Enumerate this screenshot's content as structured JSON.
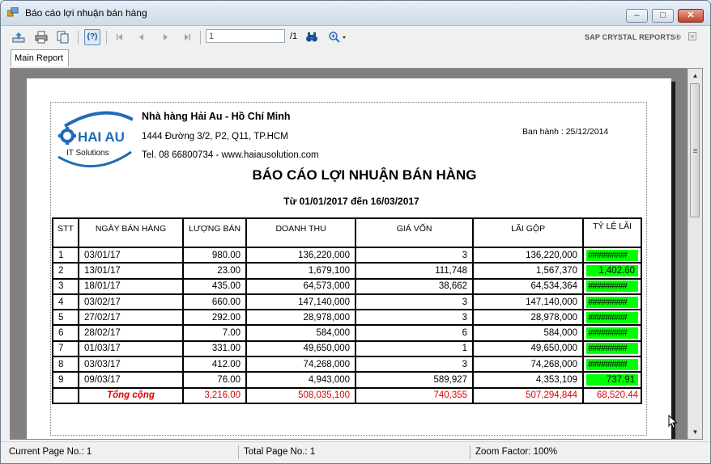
{
  "window": {
    "title": "Báo cáo lợi nhuận bán hàng",
    "buttons": {
      "minimize": "–",
      "maximize": "□",
      "close": "✕"
    }
  },
  "toolbar": {
    "page_input_value": "1",
    "page_total": "/1",
    "brand": "SAP CRYSTAL REPORTS®",
    "help_label": "(?)",
    "brand_close": "✕"
  },
  "tabs": [
    {
      "label": "Main Report"
    }
  ],
  "report": {
    "company_name": "Nhà hàng Hải Au - Hồ Chí Minh",
    "address": "1444 Đường 3/2, P2, Q11, TP.HCM",
    "phone_web": "Tel. 08 66800734 - www.haiausolution.com",
    "issued": "Ban hành : 25/12/2014",
    "logo": {
      "name": "HAI AU",
      "tagline": "IT Solutions"
    },
    "title": "BÁO CÁO LỢI NHUẬN BÁN HÀNG",
    "period": "Từ 01/01/2017 đến 16/03/2017",
    "headers": [
      "STT",
      "NGÀY BÁN HÀNG",
      "LƯỢNG  BÁN",
      "DOANH THU",
      "GIÁ VỐN",
      "LÃI GỘP",
      "TỶ LỆ LÃI"
    ],
    "rows": [
      {
        "stt": "1",
        "date": "03/01/17",
        "qty": "980.00",
        "revenue": "136,220,000",
        "cost": "3",
        "profit": "136,220,000",
        "ratio": "#########"
      },
      {
        "stt": "2",
        "date": "13/01/17",
        "qty": "23.00",
        "revenue": "1,679,100",
        "cost": "111,748",
        "profit": "1,567,370",
        "ratio": "1,402.60"
      },
      {
        "stt": "3",
        "date": "18/01/17",
        "qty": "435.00",
        "revenue": "64,573,000",
        "cost": "38,662",
        "profit": "64,534,364",
        "ratio": "#########"
      },
      {
        "stt": "4",
        "date": "03/02/17",
        "qty": "660.00",
        "revenue": "147,140,000",
        "cost": "3",
        "profit": "147,140,000",
        "ratio": "#########"
      },
      {
        "stt": "5",
        "date": "27/02/17",
        "qty": "292.00",
        "revenue": "28,978,000",
        "cost": "3",
        "profit": "28,978,000",
        "ratio": "#########"
      },
      {
        "stt": "6",
        "date": "28/02/17",
        "qty": "7.00",
        "revenue": "584,000",
        "cost": "6",
        "profit": "584,000",
        "ratio": "#########"
      },
      {
        "stt": "7",
        "date": "01/03/17",
        "qty": "331.00",
        "revenue": "49,650,000",
        "cost": "1",
        "profit": "49,650,000",
        "ratio": "#########"
      },
      {
        "stt": "8",
        "date": "03/03/17",
        "qty": "412.00",
        "revenue": "74,268,000",
        "cost": "3",
        "profit": "74,268,000",
        "ratio": "#########"
      },
      {
        "stt": "9",
        "date": "09/03/17",
        "qty": "76.00",
        "revenue": "4,943,000",
        "cost": "589,927",
        "profit": "4,353,109",
        "ratio": "737.91"
      }
    ],
    "total": {
      "label": "Tổng cộng",
      "qty": "3,216.00",
      "revenue": "508,035,100",
      "cost": "740,355",
      "profit": "507,294,844",
      "ratio": "68,520.44"
    }
  },
  "statusbar": {
    "current_page": "Current Page No.: 1",
    "total_page": "Total Page No.: 1",
    "zoom": "Zoom Factor: 100%"
  },
  "colors": {
    "ratio_fill": "#00ff00",
    "total_text": "#e00000",
    "logo_blue": "#1e6bb8"
  }
}
